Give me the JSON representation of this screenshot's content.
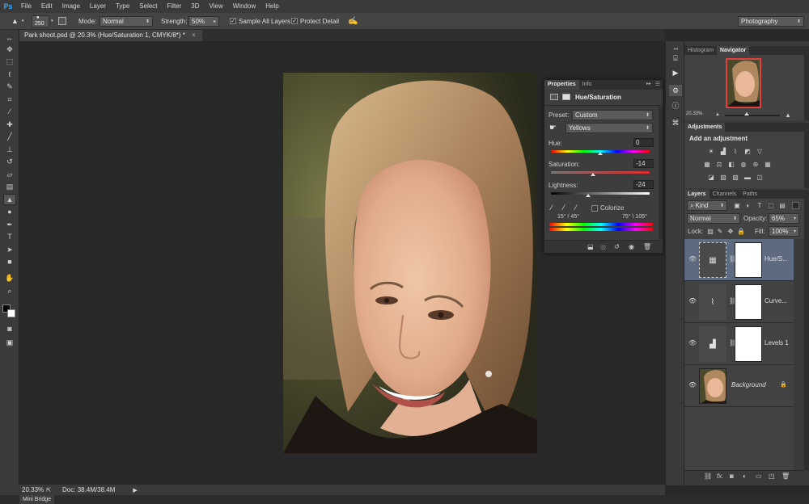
{
  "app": {
    "logo": "Ps",
    "menu": [
      "File",
      "Edit",
      "Image",
      "Layer",
      "Type",
      "Select",
      "Filter",
      "3D",
      "View",
      "Window",
      "Help"
    ],
    "workspace": "Photography"
  },
  "options": {
    "brush_size": "250",
    "mode_label": "Mode:",
    "mode_value": "Normal",
    "strength_label": "Strength:",
    "strength_value": "50%",
    "sample_all_layers": "Sample All Layers",
    "protect_detail": "Protect Detail"
  },
  "document": {
    "tab_title": "Park shoot.psd @ 20.3% (Hue/Saturation 1, CMYK/8*) *",
    "close": "×"
  },
  "status": {
    "zoom": "20.33%",
    "doc_info": "Doc: 38.4M/38.4M"
  },
  "mini_bridge": "Mini Bridge",
  "properties": {
    "tabs": [
      "Properties",
      "Info"
    ],
    "title": "Hue/Saturation",
    "preset_label": "Preset:",
    "preset_value": "Custom",
    "channel_value": "Yellows",
    "hue_label": "Hue:",
    "hue_value": "0",
    "saturation_label": "Saturation:",
    "saturation_value": "-14",
    "lightness_label": "Lightness:",
    "lightness_value": "-24",
    "colorize_label": "Colorize",
    "range_left": "15° / 45°",
    "range_right": "75° \\ 105°"
  },
  "navigator": {
    "tabs": [
      "Histogram",
      "Navigator"
    ],
    "zoom": "20.33%"
  },
  "adjustments": {
    "tab": "Adjustments",
    "heading": "Add an adjustment"
  },
  "layers": {
    "tabs": [
      "Layers",
      "Channels",
      "Paths"
    ],
    "kind": "Kind",
    "blend_mode": "Normal",
    "opacity_label": "Opacity:",
    "opacity_value": "65%",
    "lock_label": "Lock:",
    "fill_label": "Fill:",
    "fill_value": "100%",
    "items": [
      {
        "name": "Hue/S...",
        "selected": true
      },
      {
        "name": "Curve..."
      },
      {
        "name": "Levels 1"
      },
      {
        "name": "Background"
      }
    ],
    "footer_icons": [
      "link-icon",
      "fx-icon",
      "mask-icon",
      "adjustment-icon",
      "folder-icon",
      "new-layer-icon",
      "trash-icon"
    ]
  },
  "colors": {
    "accent": "#31a8ff",
    "selected_layer": "#5d6a80",
    "panel_bg": "#3a3a3a",
    "canvas_bg": "#282828"
  }
}
